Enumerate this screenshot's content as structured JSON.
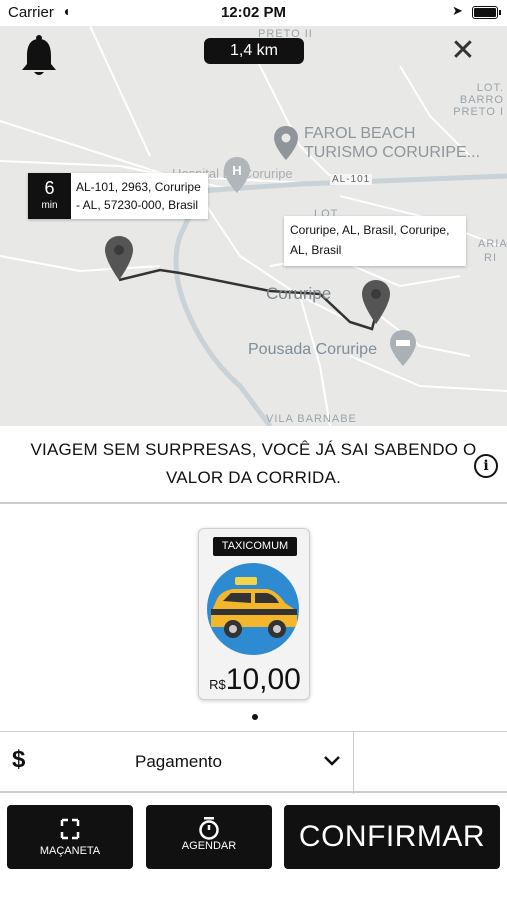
{
  "status_bar": {
    "carrier": "Carrier",
    "time": "12:02 PM"
  },
  "map": {
    "distance": "1,4 km",
    "eta_minutes": "6",
    "eta_unit": "min",
    "origin_address": "AL-101, 2963, Coruripe - AL, 57230-000, Brasil",
    "destination_address": "Coruripe, AL, Brasil, Coruripe, AL, Brasil",
    "labels": {
      "farol_line1": "FAROL BEACH",
      "farol_line2": "TURISMO CORURIPE...",
      "hospital": "Hospital De Coruripe",
      "al101": "AL-101",
      "coruripe": "Coruripe",
      "pousada": "Pousada Coruripe",
      "lot_barro_1": "LOT. BARRO",
      "lot_barro_2": "PRETO I",
      "preto_ii": "PRETO II",
      "vila_barnabe": "VILA BARNABE",
      "aria": "ARIA",
      "ri": "RI",
      "lot": "LOT"
    },
    "route_color": "#333333"
  },
  "banner": {
    "text": "VIAGEM SEM SURPRESAS, VOCÊ JÁ SAI SABENDO O VALOR DA CORRIDA."
  },
  "ride_option": {
    "tag": "TAXICOMUM",
    "currency": "R$",
    "price": "10,00"
  },
  "payment": {
    "label": "Pagamento"
  },
  "buttons": {
    "macaneta": "MAÇANETA",
    "agendar": "AGENDAR",
    "confirmar": "CONFIRMAR"
  }
}
